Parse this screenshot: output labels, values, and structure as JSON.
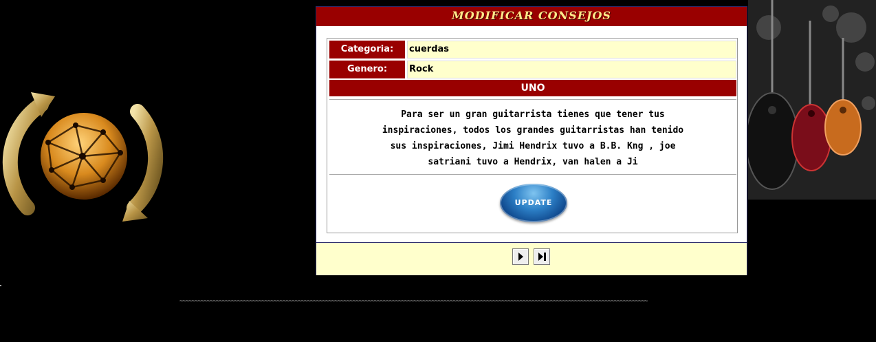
{
  "panel": {
    "title": "Modificar Consejos"
  },
  "form": {
    "categoria_label": "Categoria:",
    "categoria_value": "cuerdas",
    "genero_label": "Genero:",
    "genero_value": "Rock",
    "subheading": "UNO",
    "consejo_text": "Para ser un gran guitarrista tienes que tener tus inspiraciones, todos los grandes guitarristas han tenido sus inspiraciones, Jimi Hendrix tuvo a B.B. Kng , joe satriani tuvo a Hendrix, van halen a Ji",
    "update_label": "UPDATE"
  },
  "nav": {
    "next_icon": "play-next-icon",
    "last_icon": "skip-last-icon"
  },
  "footer": {
    "divider": "~~~~~~~~~~~~~~~~~~~~~~~~~~~~~~~~~~~~~~~~~~~~~~~~~~~~~~~~~~~~~~~~~~~~~~~~~~~~~~~~~~~~~~~~~~~~~~~~~~~~~~~~~~~~~~~~~~~~~~~~~~~~~~~~~~~~~~~~~~~~~~~~~~~~~~~~~~"
  },
  "colors": {
    "header_red": "#990000",
    "title_yellow": "#ffe98a",
    "field_bg": "#ffffcc"
  }
}
